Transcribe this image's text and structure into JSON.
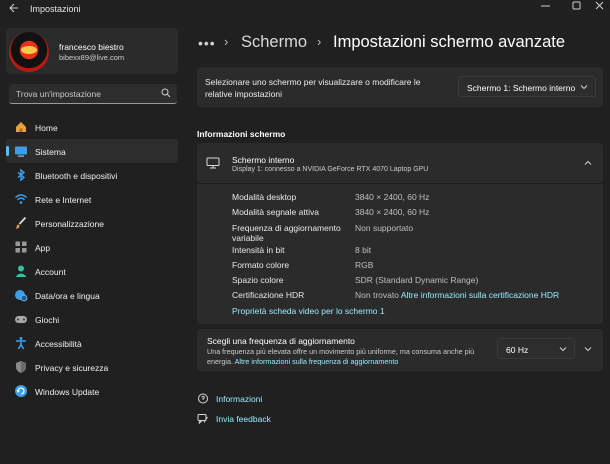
{
  "window": {
    "title": "Impostazioni"
  },
  "user": {
    "name": "francesco biestro",
    "email": "bibexx89@live.com"
  },
  "search": {
    "placeholder": "Trova un'impostazione"
  },
  "nav": [
    {
      "label": "Home",
      "icon": "home-icon",
      "selected": false
    },
    {
      "label": "Sistema",
      "icon": "display-icon",
      "selected": true
    },
    {
      "label": "Bluetooth e dispositivi",
      "icon": "bluetooth-icon",
      "selected": false
    },
    {
      "label": "Rete e Internet",
      "icon": "wifi-icon",
      "selected": false
    },
    {
      "label": "Personalizzazione",
      "icon": "brush-icon",
      "selected": false
    },
    {
      "label": "App",
      "icon": "apps-icon",
      "selected": false
    },
    {
      "label": "Account",
      "icon": "person-icon",
      "selected": false
    },
    {
      "label": "Data/ora e lingua",
      "icon": "globe-clock-icon",
      "selected": false
    },
    {
      "label": "Giochi",
      "icon": "gamepad-icon",
      "selected": false
    },
    {
      "label": "Accessibilità",
      "icon": "accessibility-icon",
      "selected": false
    },
    {
      "label": "Privacy e sicurezza",
      "icon": "shield-icon",
      "selected": false
    },
    {
      "label": "Windows Update",
      "icon": "update-icon",
      "selected": false
    }
  ],
  "breadcrumb": {
    "dots": "•••",
    "parent": "Schermo",
    "current": "Impostazioni schermo avanzate"
  },
  "display_selector": {
    "label": "Selezionare uno schermo per visualizzare o modificare le relative impostazioni",
    "selected": "Schermo 1: Schermo interno"
  },
  "info_section": {
    "title": "Informazioni schermo",
    "display_name": "Schermo interno",
    "display_sub": "Display 1: connesso a NVIDIA GeForce RTX 4070 Laptop GPU",
    "rows": [
      {
        "label": "Modalità desktop",
        "value": "3840 × 2400, 60 Hz"
      },
      {
        "label": "Modalità segnale attiva",
        "value": "3840 × 2400, 60 Hz"
      },
      {
        "label": "Frequenza di aggiornamento variabile",
        "value": "Non supportato"
      },
      {
        "label": "Intensità in bit",
        "value": "8 bit"
      },
      {
        "label": "Formato colore",
        "value": "RGB"
      },
      {
        "label": "Spazio colore",
        "value": "SDR (Standard Dynamic Range)"
      },
      {
        "label": "Certificazione HDR",
        "value": "Non trovato",
        "link": "Altre informazioni sulla certificazione HDR"
      }
    ],
    "adapter_link": "Proprietà scheda video per lo schermo 1"
  },
  "refresh_rate": {
    "title": "Scegli una frequenza di aggiornamento",
    "description": "Una frequenza più elevata offre un movimento più uniforme, ma consuma anche più energia.",
    "link": "Altre informazioni sulla frequenza di aggiornamento",
    "value": "60 Hz"
  },
  "footer": {
    "help": "Informazioni",
    "feedback": "Invia feedback"
  },
  "colors": {
    "accent": "#4cc2ff",
    "link": "#99ebff",
    "background": "#202020",
    "card": "#2b2b2b"
  }
}
